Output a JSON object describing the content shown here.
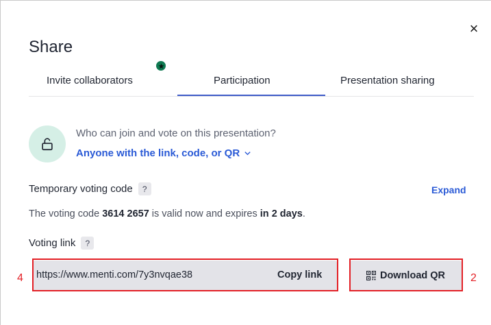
{
  "dialog": {
    "title": "Share",
    "close_symbol": "×"
  },
  "tabs": [
    {
      "label": "Invite collaborators",
      "active": false,
      "has_new_badge": true
    },
    {
      "label": "Participation",
      "active": true
    },
    {
      "label": "Presentation sharing",
      "active": false
    }
  ],
  "access": {
    "question": "Who can join and vote on this presentation?",
    "selected": "Anyone with the link, code, or QR",
    "icon": "unlock-icon"
  },
  "temporary_code": {
    "label": "Temporary voting code",
    "help": "?",
    "expand_label": "Expand",
    "text_prefix": "The voting code",
    "code": "3614 2657",
    "text_middle": "is valid now and expires",
    "expiry": "in 2 days",
    "text_suffix": "."
  },
  "voting_link": {
    "label": "Voting link",
    "help": "?",
    "url": "https://www.menti.com/7y3nvqae38",
    "copy_label": "Copy link",
    "qr_label": "Download QR"
  },
  "annotations": {
    "link_marker": "4",
    "qr_marker": "2"
  },
  "colors": {
    "accent_blue": "#2a5ad6",
    "tab_underline": "#3c59c7",
    "lock_bg": "#d5efe6",
    "annotation_red": "#e31e24",
    "badge_green": "#0f7a52"
  }
}
